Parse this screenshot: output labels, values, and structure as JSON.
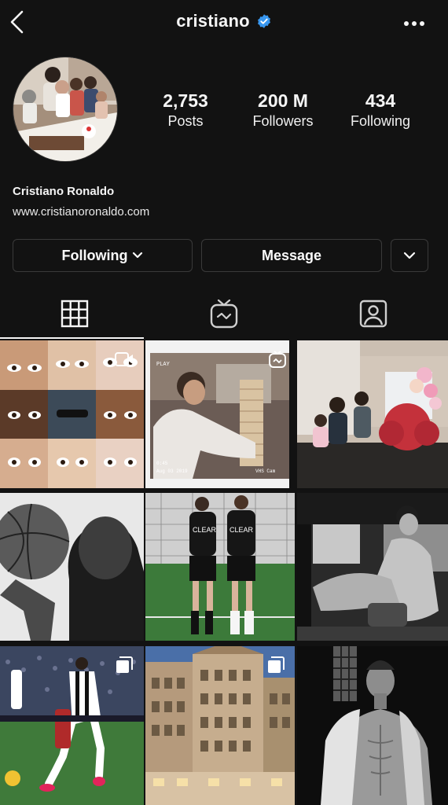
{
  "header": {
    "username": "cristiano",
    "back_icon": "chevron-left-icon",
    "verified_icon": "verified-badge-icon",
    "more_icon": "more-horizontal-icon"
  },
  "profile": {
    "stats": [
      {
        "value": "2,753",
        "label": "Posts"
      },
      {
        "value": "200 M",
        "label": "Followers"
      },
      {
        "value": "434",
        "label": "Following"
      }
    ],
    "full_name": "Cristiano Ronaldo",
    "website": "www.cristianoronaldo.com"
  },
  "actions": {
    "following_label": "Following",
    "message_label": "Message"
  },
  "tabs": [
    {
      "icon": "grid-icon",
      "active": true
    },
    {
      "icon": "igtv-icon",
      "active": false
    },
    {
      "icon": "tagged-person-icon",
      "active": false
    }
  ],
  "colors": {
    "background": "#121212",
    "text": "#f5f5f5",
    "border": "#3a3a3a",
    "verified": "#3897f0"
  }
}
